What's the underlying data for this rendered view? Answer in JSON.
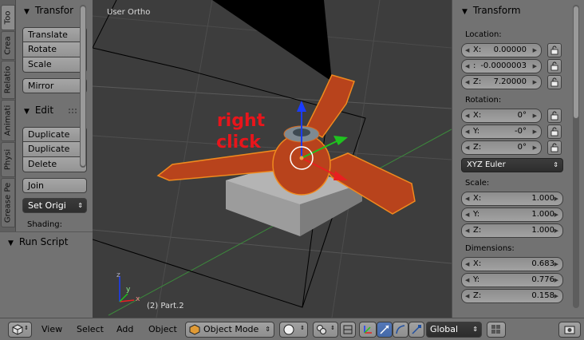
{
  "left_tabs": [
    "Too",
    "Crea",
    "Relatio",
    "Animati",
    "Physi",
    "Grease Pe"
  ],
  "transform_panel": {
    "title": "Transfor",
    "buttons": [
      "Translate",
      "Rotate",
      "Scale",
      "Mirror"
    ]
  },
  "edit_panel": {
    "title": "Edit",
    "buttons": [
      "Duplicate",
      "Duplicate",
      "Delete",
      "Join"
    ],
    "set_origin": "Set Origi",
    "shading_label": "Shading:"
  },
  "run_script": {
    "title": "Run Script"
  },
  "viewport": {
    "view_label": "User Ortho",
    "object_label": "(2) Part.2",
    "annotation_line1": "right",
    "annotation_line2": "click",
    "annotation_color": "#e8151b",
    "axis_x": "x",
    "axis_y": "y",
    "axis_z": "z"
  },
  "properties": {
    "title": "Transform",
    "location_label": "Location:",
    "location": [
      {
        "axis": "X:",
        "value": "0.00000"
      },
      {
        "axis": ":",
        "value": "-0.0000003"
      },
      {
        "axis": "Z:",
        "value": "7.20000"
      }
    ],
    "rotation_label": "Rotation:",
    "rotation": [
      {
        "axis": "X:",
        "value": "0°"
      },
      {
        "axis": "Y:",
        "value": "-0°"
      },
      {
        "axis": "Z:",
        "value": "0°"
      }
    ],
    "rotation_mode": "XYZ Euler",
    "scale_label": "Scale:",
    "scale": [
      {
        "axis": "X:",
        "value": "1.000"
      },
      {
        "axis": "Y:",
        "value": "1.000"
      },
      {
        "axis": "Z:",
        "value": "1.000"
      }
    ],
    "dimensions_label": "Dimensions:",
    "dimensions": [
      {
        "axis": "X:",
        "value": "0.683"
      },
      {
        "axis": "Y:",
        "value": "0.776"
      },
      {
        "axis": "Z:",
        "value": "0.158"
      }
    ]
  },
  "header": {
    "menus": [
      "View",
      "Select",
      "Add",
      "Object"
    ],
    "mode": "Object Mode",
    "orientation": "Global"
  },
  "colors": {
    "object_orange": "#b8431c",
    "selection_outline": "#f08a1e",
    "manipulator_blue": "#1a3cff",
    "manipulator_green": "#1fc21f",
    "manipulator_red": "#e82020"
  },
  "icons": {
    "editor_type": "cube-icon",
    "lock": "padlock-icon",
    "shading": "sphere-icon",
    "pivot": "pivot-icon",
    "manipulator": "manipulator-icon"
  }
}
